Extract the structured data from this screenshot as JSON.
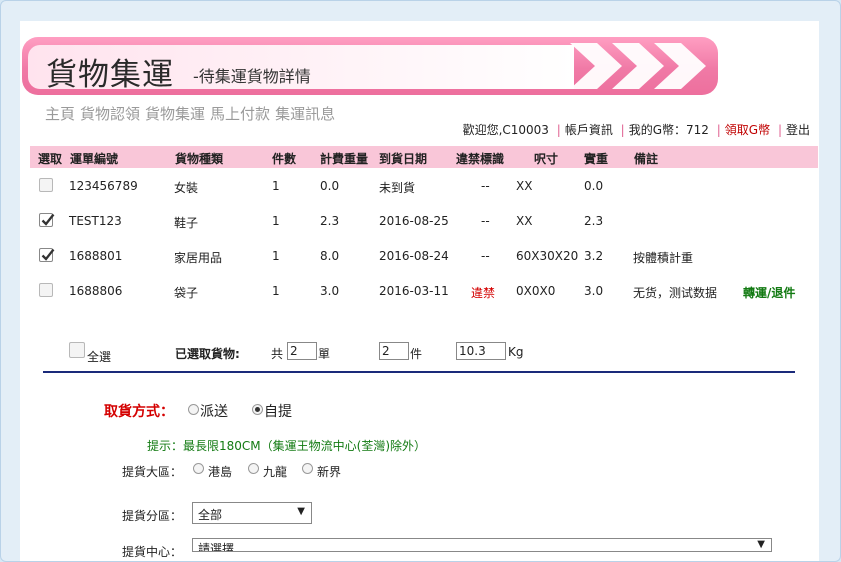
{
  "banner": {
    "title": "貨物集運",
    "subtitle": "-待集運貨物詳情"
  },
  "nav": [
    "主頁",
    "貨物認領",
    "貨物集運",
    "馬上付款",
    "集運訊息"
  ],
  "userbar": {
    "welcome": "歡迎您,C10003",
    "account": "帳戶資訊",
    "gcoin": "我的G幣：712",
    "claim": "領取G幣",
    "logout": "登出"
  },
  "table": {
    "headers": [
      "選取",
      "運單編號",
      "貨物種類",
      "件數",
      "計費重量",
      "到貨日期",
      "違禁標識",
      "呎寸",
      "實重",
      "備註"
    ],
    "rows": [
      {
        "checked": false,
        "id": "123456789",
        "type": "女裝",
        "qty": "1",
        "chg": "0.0",
        "date": "未到貨",
        "flag": "--",
        "size": "XX",
        "weight": "0.0",
        "note": "",
        "action": ""
      },
      {
        "checked": true,
        "id": "TEST123",
        "type": "鞋子",
        "qty": "1",
        "chg": "2.3",
        "date": "2016-08-25",
        "flag": "--",
        "size": "XX",
        "weight": "2.3",
        "note": "",
        "action": ""
      },
      {
        "checked": true,
        "id": "1688801",
        "type": "家居用品",
        "qty": "1",
        "chg": "8.0",
        "date": "2016-08-24",
        "flag": "--",
        "size": "60X30X20",
        "weight": "3.2",
        "note": "按體積計重",
        "action": ""
      },
      {
        "checked": false,
        "id": "1688806",
        "type": "袋子",
        "qty": "1",
        "chg": "3.0",
        "date": "2016-03-11",
        "flag": "違禁",
        "size": "0X0X0",
        "weight": "3.0",
        "note": "无货，测试数据",
        "action": "轉運/退件"
      }
    ]
  },
  "summary": {
    "select_all": "全選",
    "selected_label": "已選取貨物:",
    "total_prefix": "共",
    "order_count": "2",
    "order_unit": "單",
    "piece_count": "2",
    "piece_unit": "件",
    "weight": "10.3",
    "weight_unit": "Kg"
  },
  "pickup": {
    "label": "取貨方式：",
    "options": [
      "派送",
      "自提"
    ],
    "selected": "自提",
    "hint": "提示：最長限180CM（集運王物流中心(荃灣)除外）",
    "region_label": "提貨大區：",
    "regions": [
      "港島",
      "九龍",
      "新界"
    ],
    "district_label": "提貨分區：",
    "district_value": "全部",
    "center_label": "提貨中心：",
    "center_value": "請選擇"
  },
  "colors": {
    "banner_pink": "#ed6f9d",
    "header_pink": "#f9c6d8",
    "alert_red": "#d40000",
    "ok_green": "#127a12",
    "divider_navy": "#1a2a7a"
  }
}
